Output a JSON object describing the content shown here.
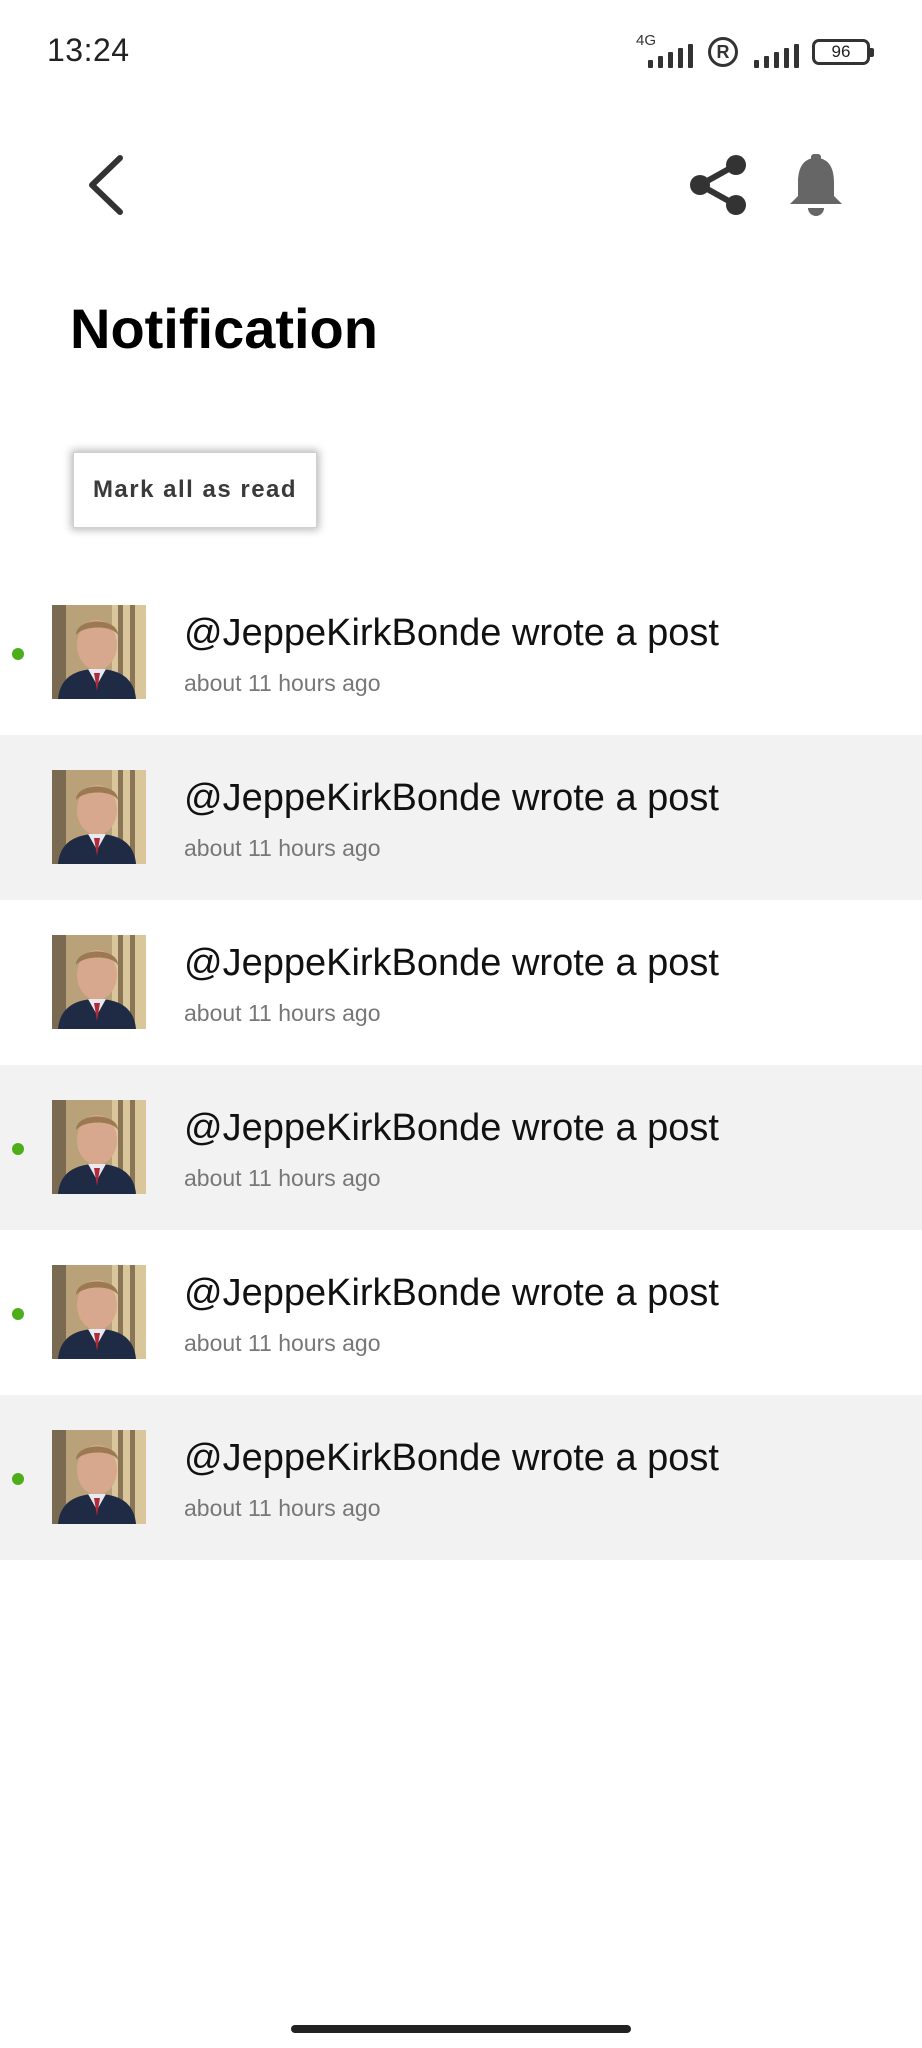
{
  "status_bar": {
    "time": "13:24",
    "network_tag": "4G",
    "battery": "96"
  },
  "header": {
    "back_icon": "chevron-left-icon",
    "share_icon": "share-icon",
    "bell_icon": "bell-icon"
  },
  "page": {
    "title": "Notification",
    "mark_all_label": "Mark all as read"
  },
  "notifications": [
    {
      "text": "@JeppeKirkBonde wrote a post",
      "time": "about 11 hours ago",
      "unread": true
    },
    {
      "text": "@JeppeKirkBonde wrote a post",
      "time": "about 11 hours ago",
      "unread": false
    },
    {
      "text": "@JeppeKirkBonde wrote a post",
      "time": "about 11 hours ago",
      "unread": false
    },
    {
      "text": "@JeppeKirkBonde wrote a post",
      "time": "about 11 hours ago",
      "unread": true
    },
    {
      "text": "@JeppeKirkBonde wrote a post",
      "time": "about 11 hours ago",
      "unread": true
    },
    {
      "text": "@JeppeKirkBonde wrote a post",
      "time": "about 11 hours ago",
      "unread": true
    }
  ],
  "colors": {
    "unread_dot": "#4caf1a",
    "alt_row": "#f2f2f2"
  }
}
